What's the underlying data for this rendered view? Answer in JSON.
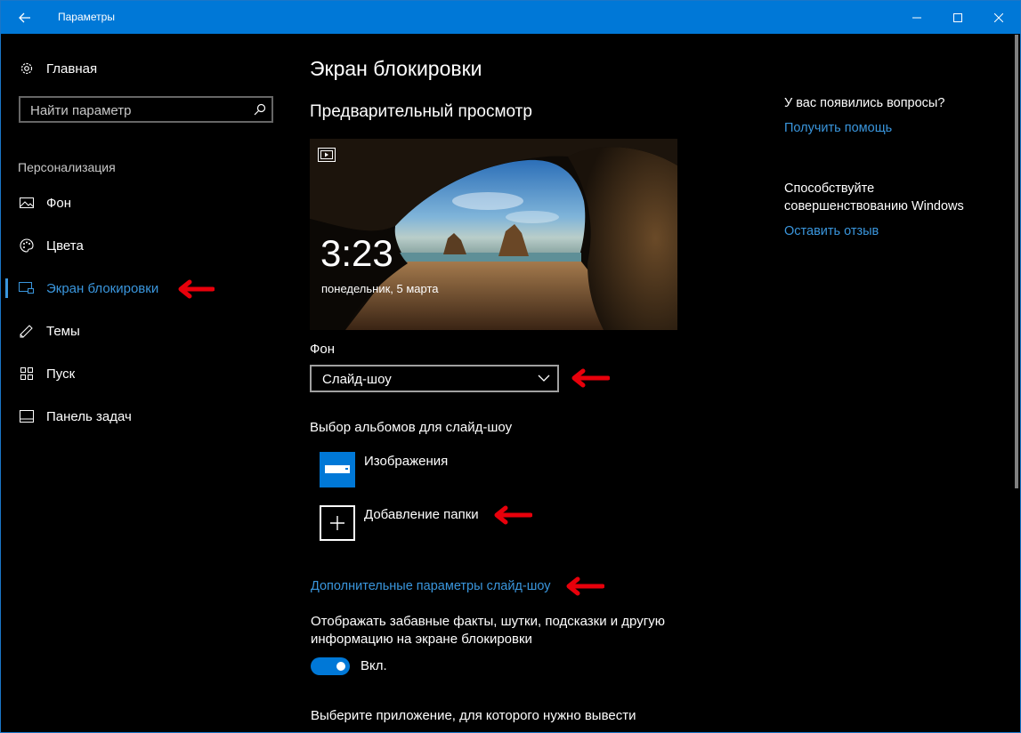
{
  "titlebar": {
    "title": "Параметры"
  },
  "sidebar": {
    "home_label": "Главная",
    "search_placeholder": "Найти параметр",
    "section_label": "Персонализация",
    "items": [
      {
        "label": "Фон",
        "icon": "picture-icon"
      },
      {
        "label": "Цвета",
        "icon": "palette-icon"
      },
      {
        "label": "Экран блокировки",
        "icon": "lock-screen-icon",
        "selected": true
      },
      {
        "label": "Темы",
        "icon": "brush-icon"
      },
      {
        "label": "Пуск",
        "icon": "start-icon"
      },
      {
        "label": "Панель задач",
        "icon": "taskbar-icon"
      }
    ]
  },
  "main": {
    "title": "Экран блокировки",
    "preview_title": "Предварительный просмотр",
    "preview": {
      "time": "3:23",
      "date": "понедельник, 5 марта"
    },
    "background_label": "Фон",
    "background_value": "Слайд-шоу",
    "albums_label": "Выбор альбомов для слайд-шоу",
    "album_images": "Изображения",
    "album_add": "Добавление папки",
    "advanced_link": "Дополнительные параметры слайд-шоу",
    "facts_text_1": "Отображать забавные факты, шутки, подсказки и другую",
    "facts_text_2": "информацию на экране блокировки",
    "toggle_state": "Вкл.",
    "choose_app_text": "Выберите приложение, для которого нужно вывести"
  },
  "right": {
    "questions_title": "У вас появились вопросы?",
    "help_link": "Получить помощь",
    "improve_line1": "Способствуйте",
    "improve_line2": "совершенствованию Windows",
    "feedback_link": "Оставить отзыв"
  },
  "colors": {
    "accent": "#0078d7",
    "link": "#3a96dd",
    "annotation_arrow": "#e8000b"
  }
}
